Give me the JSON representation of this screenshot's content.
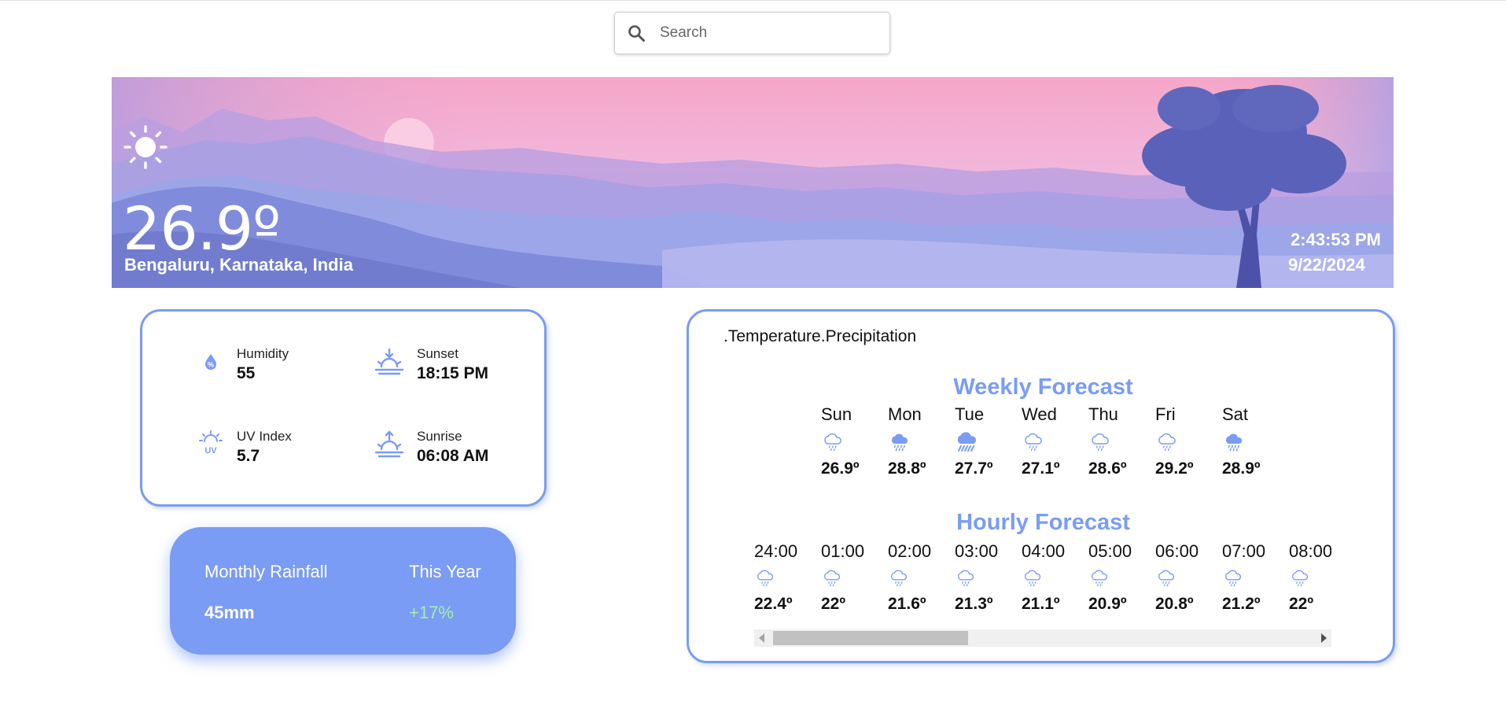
{
  "search": {
    "placeholder": "Search",
    "icon": "search-icon"
  },
  "current": {
    "temperature": "26.9º",
    "location": "Bengaluru, Karnataka, India",
    "time": "2:43:53 PM",
    "date": "9/22/2024",
    "icon": "sun-icon"
  },
  "stats": {
    "humidity": {
      "label": "Humidity",
      "value": "55",
      "icon": "humidity-icon"
    },
    "sunset": {
      "label": "Sunset",
      "value": "18:15 PM",
      "icon": "sunset-icon"
    },
    "uv": {
      "label": "UV Index",
      "value": "5.7",
      "icon": "uv-index-icon"
    },
    "sunrise": {
      "label": "Sunrise",
      "value": "06:08 AM",
      "icon": "sunrise-icon"
    }
  },
  "rainfall": {
    "label": "Monthly Rainfall",
    "value": "45mm",
    "period_label": "This Year",
    "change": "+17%",
    "change_color": "#a6f0a3"
  },
  "forecast": {
    "tabs": [
      ".Temperature",
      ".Precipitation"
    ],
    "weekly_title": "Weekly Forecast",
    "weekly": [
      {
        "day": "Sun",
        "temp": "26.9º",
        "icon": "light-rain-icon"
      },
      {
        "day": "Mon",
        "temp": "28.8º",
        "icon": "heavy-rain-icon"
      },
      {
        "day": "Tue",
        "temp": "27.7º",
        "icon": "storm-rain-icon"
      },
      {
        "day": "Wed",
        "temp": "27.1º",
        "icon": "light-rain-icon"
      },
      {
        "day": "Thu",
        "temp": "28.6º",
        "icon": "light-rain-icon"
      },
      {
        "day": "Fri",
        "temp": "29.2º",
        "icon": "light-rain-icon"
      },
      {
        "day": "Sat",
        "temp": "28.9º",
        "icon": "heavy-rain-icon"
      }
    ],
    "hourly_title": "Hourly Forecast",
    "hourly": [
      {
        "hour": "24:00",
        "temp": "22.4º",
        "icon": "light-rain-icon"
      },
      {
        "hour": "01:00",
        "temp": "22º",
        "icon": "light-rain-icon"
      },
      {
        "hour": "02:00",
        "temp": "21.6º",
        "icon": "light-rain-icon"
      },
      {
        "hour": "03:00",
        "temp": "21.3º",
        "icon": "light-rain-icon"
      },
      {
        "hour": "04:00",
        "temp": "21.1º",
        "icon": "light-rain-icon"
      },
      {
        "hour": "05:00",
        "temp": "20.9º",
        "icon": "light-rain-icon"
      },
      {
        "hour": "06:00",
        "temp": "20.8º",
        "icon": "light-rain-icon"
      },
      {
        "hour": "07:00",
        "temp": "21.2º",
        "icon": "light-rain-icon"
      },
      {
        "hour": "08:00",
        "temp": "22º",
        "icon": "light-rain-icon"
      }
    ]
  },
  "colors": {
    "accent": "#7a9cf4",
    "card_border": "#7a9cf1"
  }
}
